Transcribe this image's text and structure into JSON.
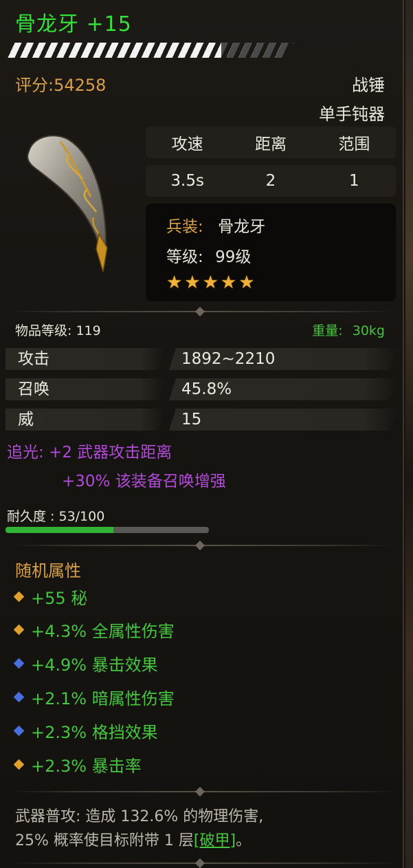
{
  "item": {
    "name": "骨龙牙 +15",
    "score": "评分:54258",
    "type": "战锤",
    "subtype": "单手钝器"
  },
  "stats_table": {
    "headers": [
      "攻速",
      "距离",
      "范围"
    ],
    "values": [
      "3.5s",
      "2",
      "1"
    ]
  },
  "info": {
    "set_label": "兵装:",
    "set_value": "骨龙牙",
    "level_label": "等级:",
    "level_value": "99级",
    "stars": "★★★★★",
    "star_count": 5
  },
  "meta": {
    "item_level": "物品等级: 119",
    "weight_label": "重量:",
    "weight_value": "30kg"
  },
  "properties": [
    {
      "label": "攻击",
      "value": "1892~2210",
      "color": "#eeeae2"
    },
    {
      "label": "召唤",
      "value": "45.8%",
      "color": "#46c640"
    },
    {
      "label": "威",
      "value": "15",
      "color": "#eeeae2"
    }
  ],
  "special": {
    "line1": "追光: +2 武器攻击距离",
    "line2": "+30% 该装备召唤增强"
  },
  "durability": {
    "label": "耐久度 : 53/100",
    "fraction": 0.53
  },
  "random_attrs": {
    "title": "随机属性",
    "items": [
      {
        "text": "+55 秘",
        "gem": "gold"
      },
      {
        "text": "+4.3% 全属性伤害",
        "gem": "gold"
      },
      {
        "text": "+4.9% 暴击效果",
        "gem": "blue"
      },
      {
        "text": "+2.1% 暗属性伤害",
        "gem": "blue"
      },
      {
        "text": "+2.3% 格挡效果",
        "gem": "blue"
      },
      {
        "text": "+2.3% 暴击率",
        "gem": "gold"
      }
    ]
  },
  "description": {
    "line1": "武器普攻: 造成 132.6% 的物理伤害,",
    "line2_pre": "25% 概率使目标附带 1 层",
    "link": "[破甲]",
    "line2_post": "。"
  },
  "colors": {
    "name_green": "#34e03a",
    "accent_gold": "#d8a04a",
    "special_purple": "#b14ad8",
    "value_green": "#46c640"
  }
}
